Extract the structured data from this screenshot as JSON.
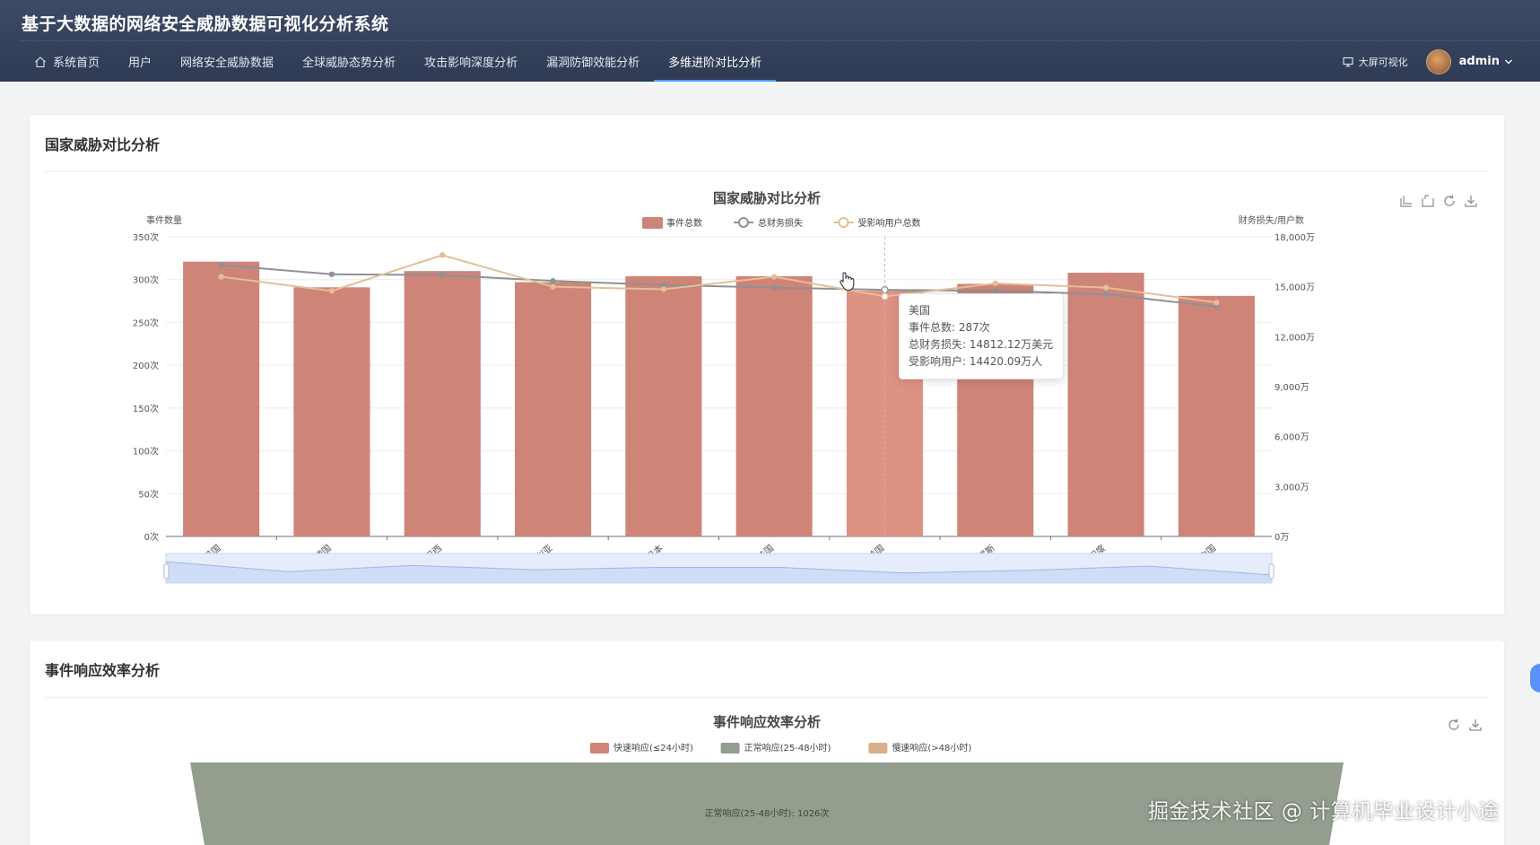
{
  "app": {
    "title": "基于大数据的网络安全威胁数据可视化分析系统"
  },
  "nav": {
    "items": [
      {
        "label": "系统首页",
        "icon": "home-icon"
      },
      {
        "label": "用户"
      },
      {
        "label": "网络安全威胁数据"
      },
      {
        "label": "全球威胁态势分析"
      },
      {
        "label": "攻击影响深度分析"
      },
      {
        "label": "漏洞防御效能分析"
      },
      {
        "label": "多维进阶对比分析",
        "active": true
      }
    ],
    "accent": "#409eff"
  },
  "header_right": {
    "bigscreen_label": "大屏可视化",
    "username": "admin"
  },
  "card1": {
    "title": "国家威胁对比分析"
  },
  "card2": {
    "title": "事件响应效率分析"
  },
  "chart_data": [
    {
      "type": "bar",
      "title": "国家威胁对比分析",
      "categories": [
        "英国",
        "德国",
        "巴西",
        "澳大利亚",
        "日本",
        "法国",
        "美国",
        "俄罗斯",
        "印度",
        "中国"
      ],
      "ylabel_left": "事件数量",
      "ylabel_right": "财务损失/用户数",
      "left_axis": {
        "min": 0,
        "max": 350,
        "step": 50,
        "unit": "次",
        "ticks": [
          "0次",
          "50次",
          "100次",
          "150次",
          "200次",
          "250次",
          "300次",
          "350次"
        ]
      },
      "right_axis": {
        "min": 0,
        "max": 18000,
        "step": 3000,
        "unit": "万",
        "ticks": [
          "0万",
          "3,000万",
          "6,000万",
          "9,000万",
          "12,000万",
          "15,000万",
          "18,000万"
        ]
      },
      "legend": [
        "事件总数",
        "总财务损失",
        "受影响用户总数"
      ],
      "legend_position": "top-center",
      "series": [
        {
          "name": "事件总数",
          "kind": "bar",
          "axis": "left",
          "color": "#cf8478",
          "highlight_color": "#de9283",
          "values": [
            321,
            291,
            310,
            297,
            304,
            304,
            287,
            295,
            308,
            281
          ]
        },
        {
          "name": "总财务损失",
          "kind": "line",
          "axis": "right",
          "color": "#8d9294",
          "values": [
            16300,
            15750,
            15700,
            15350,
            15100,
            14950,
            14812.12,
            14750,
            14550,
            13800
          ]
        },
        {
          "name": "受影响用户总数",
          "kind": "line",
          "axis": "right",
          "color": "#e3bf98",
          "values": [
            15600,
            14750,
            16900,
            15000,
            14850,
            15600,
            14420.09,
            15200,
            14950,
            14050
          ]
        }
      ],
      "hover_index": 6,
      "tooltip": {
        "title": "美国",
        "lines": [
          "事件总数: 287次",
          "总财务损失: 14812.12万美元",
          "受影响用户: 14420.09万人"
        ]
      },
      "toolbox": [
        "zoom-icon",
        "zoom-reset-icon",
        "refresh-icon",
        "download-icon"
      ],
      "datazoom": true,
      "grid": true
    },
    {
      "type": "funnel",
      "title": "事件响应效率分析",
      "legend": [
        "快速响应(≤24小时)",
        "正常响应(25-48小时)",
        "慢速响应(>48小时)"
      ],
      "colors": [
        "#cf8478",
        "#939e8e",
        "#d9b08a"
      ],
      "visible_segment": {
        "name": "正常响应(25-48小时)",
        "value": 1026,
        "label": "正常响应(25-48小时): 1026次"
      },
      "toolbox": [
        "refresh-icon",
        "download-icon"
      ]
    }
  ],
  "watermark": "掘金技术社区 @ 计算机毕业设计小途"
}
